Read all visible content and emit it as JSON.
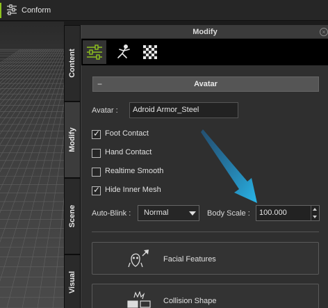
{
  "toolbar": {
    "conform_label": "Conform",
    "accent_color": "#8fc31f"
  },
  "side_tabs": [
    {
      "label": "Content"
    },
    {
      "label": "Modify"
    },
    {
      "label": "Scene"
    },
    {
      "label": "Visual"
    }
  ],
  "panel": {
    "title": "Modify",
    "close_icon": "close-icon",
    "icon_tabs": [
      "sliders-icon",
      "pose-icon",
      "checker-icon"
    ],
    "section": {
      "toggle": "−",
      "title": "Avatar"
    },
    "avatar_label": "Avatar :",
    "avatar_value": "Adroid Armor_Steel",
    "checkboxes": [
      {
        "label": "Foot Contact",
        "checked": true
      },
      {
        "label": "Hand Contact",
        "checked": false
      },
      {
        "label": "Realtime Smooth",
        "checked": false
      },
      {
        "label": "Hide Inner Mesh",
        "checked": true
      }
    ],
    "auto_blink_label": "Auto-Blink :",
    "auto_blink_value": "Normal",
    "body_scale_label": "Body Scale :",
    "body_scale_value": "100.000",
    "facial_features_label": "Facial Features",
    "collision_shape_label": "Collision Shape"
  },
  "annotation_arrow_color": "#29b6e8"
}
